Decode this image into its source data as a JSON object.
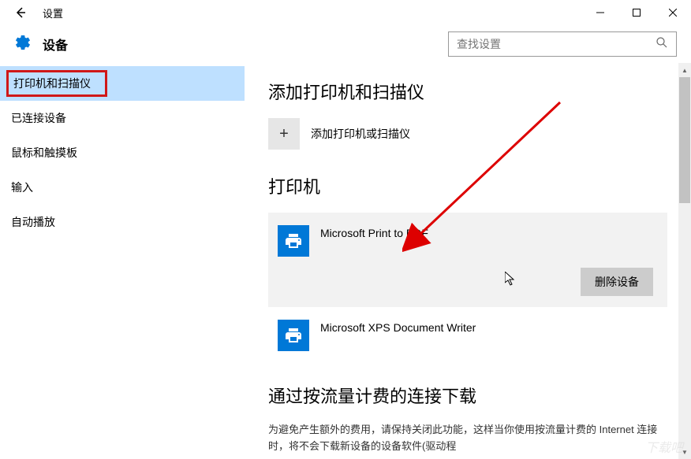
{
  "titlebar": {
    "title": "设置"
  },
  "header": {
    "title": "设备",
    "search_placeholder": "查找设置"
  },
  "sidebar": {
    "items": [
      {
        "label": "打印机和扫描仪",
        "active": true
      },
      {
        "label": "已连接设备",
        "active": false
      },
      {
        "label": "鼠标和触摸板",
        "active": false
      },
      {
        "label": "输入",
        "active": false
      },
      {
        "label": "自动播放",
        "active": false
      }
    ]
  },
  "main": {
    "section1_title": "添加打印机和扫描仪",
    "add_label": "添加打印机或扫描仪",
    "section2_title": "打印机",
    "printers": [
      {
        "name": "Microsoft Print to PDF",
        "selected": true
      },
      {
        "name": "Microsoft XPS Document Writer",
        "selected": false
      }
    ],
    "remove_button": "删除设备",
    "section3_title": "通过按流量计费的连接下载",
    "metered_text": "为避免产生额外的费用，请保持关闭此功能，这样当你使用按流量计费的 Internet 连接时，将不会下载新设备的设备软件(驱动程"
  },
  "watermark": "下载吧"
}
